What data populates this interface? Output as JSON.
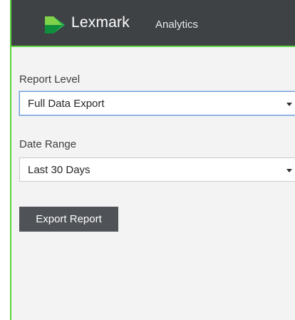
{
  "header": {
    "brand": "Lexmark",
    "product": "Analytics",
    "logo_icon": "lexmark-logo-icon",
    "accent_color": "#5cd141",
    "bar_color": "#3f4245"
  },
  "form": {
    "report_level": {
      "label": "Report Level",
      "value": "Full Data Export"
    },
    "date_range": {
      "label": "Date Range",
      "value": "Last 30 Days"
    },
    "export_button": "Export Report"
  }
}
